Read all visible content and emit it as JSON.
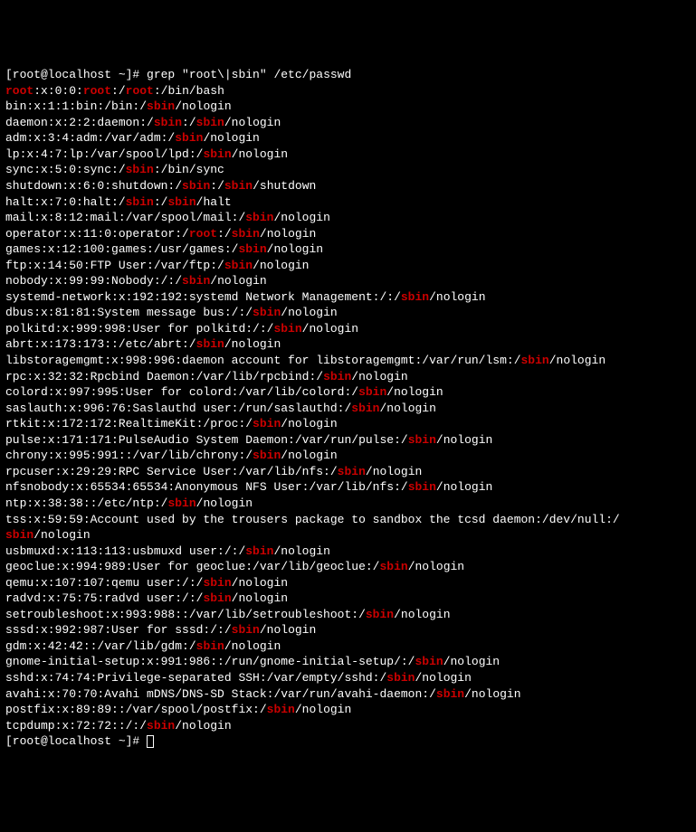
{
  "prompt1": {
    "user_host": "[root@localhost ~]# ",
    "command": "grep \"root\\|sbin\" /etc/passwd"
  },
  "prompt2": {
    "user_host": "[root@localhost ~]# "
  },
  "lines": [
    {
      "segments": [
        {
          "t": "root",
          "h": true
        },
        {
          "t": ":x:0:0:"
        },
        {
          "t": "root",
          "h": true
        },
        {
          "t": ":/"
        },
        {
          "t": "root",
          "h": true
        },
        {
          "t": ":/bin/bash"
        }
      ]
    },
    {
      "segments": [
        {
          "t": "bin:x:1:1:bin:/bin:/"
        },
        {
          "t": "sbin",
          "h": true
        },
        {
          "t": "/nologin"
        }
      ]
    },
    {
      "segments": [
        {
          "t": "daemon:x:2:2:daemon:/"
        },
        {
          "t": "sbin",
          "h": true
        },
        {
          "t": ":/"
        },
        {
          "t": "sbin",
          "h": true
        },
        {
          "t": "/nologin"
        }
      ]
    },
    {
      "segments": [
        {
          "t": "adm:x:3:4:adm:/var/adm:/"
        },
        {
          "t": "sbin",
          "h": true
        },
        {
          "t": "/nologin"
        }
      ]
    },
    {
      "segments": [
        {
          "t": "lp:x:4:7:lp:/var/spool/lpd:/"
        },
        {
          "t": "sbin",
          "h": true
        },
        {
          "t": "/nologin"
        }
      ]
    },
    {
      "segments": [
        {
          "t": "sync:x:5:0:sync:/"
        },
        {
          "t": "sbin",
          "h": true
        },
        {
          "t": ":/bin/sync"
        }
      ]
    },
    {
      "segments": [
        {
          "t": "shutdown:x:6:0:shutdown:/"
        },
        {
          "t": "sbin",
          "h": true
        },
        {
          "t": ":/"
        },
        {
          "t": "sbin",
          "h": true
        },
        {
          "t": "/shutdown"
        }
      ]
    },
    {
      "segments": [
        {
          "t": "halt:x:7:0:halt:/"
        },
        {
          "t": "sbin",
          "h": true
        },
        {
          "t": ":/"
        },
        {
          "t": "sbin",
          "h": true
        },
        {
          "t": "/halt"
        }
      ]
    },
    {
      "segments": [
        {
          "t": "mail:x:8:12:mail:/var/spool/mail:/"
        },
        {
          "t": "sbin",
          "h": true
        },
        {
          "t": "/nologin"
        }
      ]
    },
    {
      "segments": [
        {
          "t": "operator:x:11:0:operator:/"
        },
        {
          "t": "root",
          "h": true
        },
        {
          "t": ":/"
        },
        {
          "t": "sbin",
          "h": true
        },
        {
          "t": "/nologin"
        }
      ]
    },
    {
      "segments": [
        {
          "t": "games:x:12:100:games:/usr/games:/"
        },
        {
          "t": "sbin",
          "h": true
        },
        {
          "t": "/nologin"
        }
      ]
    },
    {
      "segments": [
        {
          "t": "ftp:x:14:50:FTP User:/var/ftp:/"
        },
        {
          "t": "sbin",
          "h": true
        },
        {
          "t": "/nologin"
        }
      ]
    },
    {
      "segments": [
        {
          "t": "nobody:x:99:99:Nobody:/:/"
        },
        {
          "t": "sbin",
          "h": true
        },
        {
          "t": "/nologin"
        }
      ]
    },
    {
      "segments": [
        {
          "t": "systemd-network:x:192:192:systemd Network Management:/:/"
        },
        {
          "t": "sbin",
          "h": true
        },
        {
          "t": "/nologin"
        }
      ]
    },
    {
      "segments": [
        {
          "t": "dbus:x:81:81:System message bus:/:/"
        },
        {
          "t": "sbin",
          "h": true
        },
        {
          "t": "/nologin"
        }
      ]
    },
    {
      "segments": [
        {
          "t": "polkitd:x:999:998:User for polkitd:/:/"
        },
        {
          "t": "sbin",
          "h": true
        },
        {
          "t": "/nologin"
        }
      ]
    },
    {
      "segments": [
        {
          "t": "abrt:x:173:173::/etc/abrt:/"
        },
        {
          "t": "sbin",
          "h": true
        },
        {
          "t": "/nologin"
        }
      ]
    },
    {
      "segments": [
        {
          "t": "libstoragemgmt:x:998:996:daemon account for libstoragemgmt:/var/run/lsm:/"
        },
        {
          "t": "sbin",
          "h": true
        },
        {
          "t": "/nologin"
        }
      ]
    },
    {
      "segments": [
        {
          "t": "rpc:x:32:32:Rpcbind Daemon:/var/lib/rpcbind:/"
        },
        {
          "t": "sbin",
          "h": true
        },
        {
          "t": "/nologin"
        }
      ]
    },
    {
      "segments": [
        {
          "t": "colord:x:997:995:User for colord:/var/lib/colord:/"
        },
        {
          "t": "sbin",
          "h": true
        },
        {
          "t": "/nologin"
        }
      ]
    },
    {
      "segments": [
        {
          "t": "saslauth:x:996:76:Saslauthd user:/run/saslauthd:/"
        },
        {
          "t": "sbin",
          "h": true
        },
        {
          "t": "/nologin"
        }
      ]
    },
    {
      "segments": [
        {
          "t": "rtkit:x:172:172:RealtimeKit:/proc:/"
        },
        {
          "t": "sbin",
          "h": true
        },
        {
          "t": "/nologin"
        }
      ]
    },
    {
      "segments": [
        {
          "t": "pulse:x:171:171:PulseAudio System Daemon:/var/run/pulse:/"
        },
        {
          "t": "sbin",
          "h": true
        },
        {
          "t": "/nologin"
        }
      ]
    },
    {
      "segments": [
        {
          "t": "chrony:x:995:991::/var/lib/chrony:/"
        },
        {
          "t": "sbin",
          "h": true
        },
        {
          "t": "/nologin"
        }
      ]
    },
    {
      "segments": [
        {
          "t": "rpcuser:x:29:29:RPC Service User:/var/lib/nfs:/"
        },
        {
          "t": "sbin",
          "h": true
        },
        {
          "t": "/nologin"
        }
      ]
    },
    {
      "segments": [
        {
          "t": "nfsnobody:x:65534:65534:Anonymous NFS User:/var/lib/nfs:/"
        },
        {
          "t": "sbin",
          "h": true
        },
        {
          "t": "/nologin"
        }
      ]
    },
    {
      "segments": [
        {
          "t": "ntp:x:38:38::/etc/ntp:/"
        },
        {
          "t": "sbin",
          "h": true
        },
        {
          "t": "/nologin"
        }
      ]
    },
    {
      "segments": [
        {
          "t": "tss:x:59:59:Account used by the trousers package to sandbox the tcsd daemon:/dev/null:/"
        }
      ]
    },
    {
      "segments": [
        {
          "t": "sbin",
          "h": true
        },
        {
          "t": "/nologin"
        }
      ]
    },
    {
      "segments": [
        {
          "t": "usbmuxd:x:113:113:usbmuxd user:/:/"
        },
        {
          "t": "sbin",
          "h": true
        },
        {
          "t": "/nologin"
        }
      ]
    },
    {
      "segments": [
        {
          "t": "geoclue:x:994:989:User for geoclue:/var/lib/geoclue:/"
        },
        {
          "t": "sbin",
          "h": true
        },
        {
          "t": "/nologin"
        }
      ]
    },
    {
      "segments": [
        {
          "t": "qemu:x:107:107:qemu user:/:/"
        },
        {
          "t": "sbin",
          "h": true
        },
        {
          "t": "/nologin"
        }
      ]
    },
    {
      "segments": [
        {
          "t": "radvd:x:75:75:radvd user:/:/"
        },
        {
          "t": "sbin",
          "h": true
        },
        {
          "t": "/nologin"
        }
      ]
    },
    {
      "segments": [
        {
          "t": "setroubleshoot:x:993:988::/var/lib/setroubleshoot:/"
        },
        {
          "t": "sbin",
          "h": true
        },
        {
          "t": "/nologin"
        }
      ]
    },
    {
      "segments": [
        {
          "t": "sssd:x:992:987:User for sssd:/:/"
        },
        {
          "t": "sbin",
          "h": true
        },
        {
          "t": "/nologin"
        }
      ]
    },
    {
      "segments": [
        {
          "t": "gdm:x:42:42::/var/lib/gdm:/"
        },
        {
          "t": "sbin",
          "h": true
        },
        {
          "t": "/nologin"
        }
      ]
    },
    {
      "segments": [
        {
          "t": "gnome-initial-setup:x:991:986::/run/gnome-initial-setup/:/"
        },
        {
          "t": "sbin",
          "h": true
        },
        {
          "t": "/nologin"
        }
      ]
    },
    {
      "segments": [
        {
          "t": "sshd:x:74:74:Privilege-separated SSH:/var/empty/sshd:/"
        },
        {
          "t": "sbin",
          "h": true
        },
        {
          "t": "/nologin"
        }
      ]
    },
    {
      "segments": [
        {
          "t": "avahi:x:70:70:Avahi mDNS/DNS-SD Stack:/var/run/avahi-daemon:/"
        },
        {
          "t": "sbin",
          "h": true
        },
        {
          "t": "/nologin"
        }
      ]
    },
    {
      "segments": [
        {
          "t": "postfix:x:89:89::/var/spool/postfix:/"
        },
        {
          "t": "sbin",
          "h": true
        },
        {
          "t": "/nologin"
        }
      ]
    },
    {
      "segments": [
        {
          "t": "tcpdump:x:72:72::/:/"
        },
        {
          "t": "sbin",
          "h": true
        },
        {
          "t": "/nologin"
        }
      ]
    }
  ]
}
